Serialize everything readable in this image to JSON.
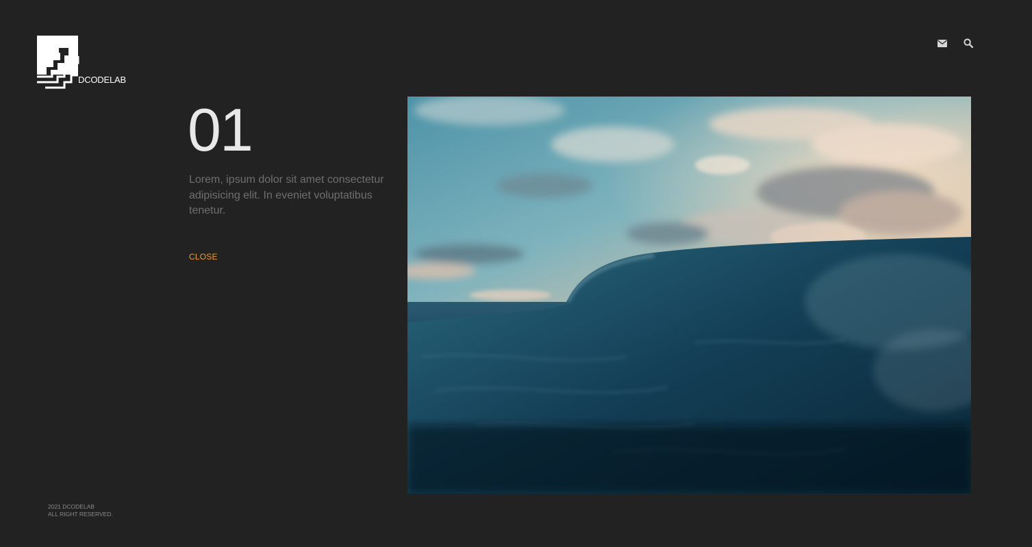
{
  "brand": {
    "name": "DCODELAB",
    "logo_icon": "stairs-logo-icon"
  },
  "header": {
    "icons": [
      "envelope-icon",
      "search-icon"
    ]
  },
  "slide": {
    "number": "01",
    "description": "Lorem, ipsum dolor sit amet consectetur adipisicing elit. In eveniet voluptatibus tenetur.",
    "close_label": "CLOSE",
    "media_subject": "ocean-wave-at-sunset"
  },
  "footer": {
    "year_line": "2021 DCODELAB",
    "rights_line": "ALL RIGHT RESERVED."
  },
  "colors": {
    "background": "#222222",
    "accent": "#f5a01a",
    "text_primary": "#e8e8e8",
    "text_muted": "#6f6f6f"
  }
}
